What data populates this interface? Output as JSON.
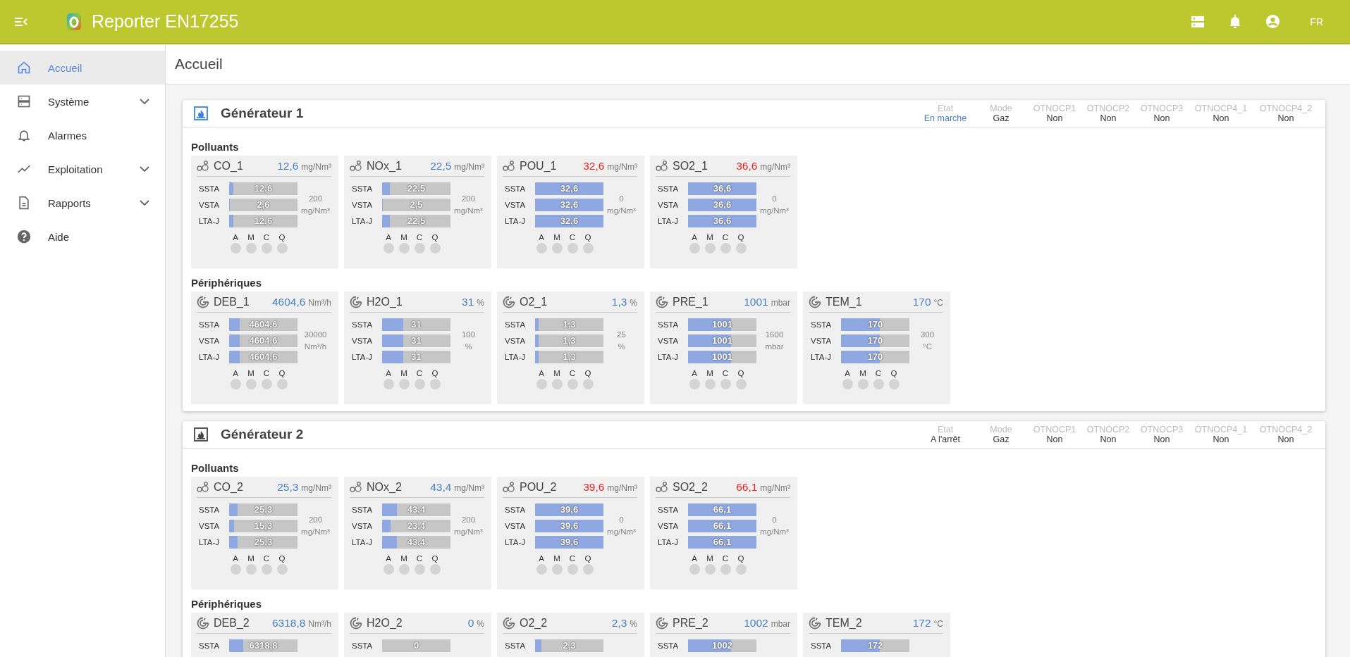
{
  "header": {
    "title": "Reporter EN17255",
    "language": "FR"
  },
  "sidebar": {
    "items": [
      {
        "label": "Accueil",
        "selected": true,
        "expandable": false
      },
      {
        "label": "Système",
        "selected": false,
        "expandable": true
      },
      {
        "label": "Alarmes",
        "selected": false,
        "expandable": false
      },
      {
        "label": "Exploitation",
        "selected": false,
        "expandable": true
      },
      {
        "label": "Rapports",
        "selected": false,
        "expandable": true
      },
      {
        "label": "Aide",
        "selected": false,
        "expandable": false
      }
    ]
  },
  "page_title": "Accueil",
  "generators": [
    {
      "name": "Générateur 1",
      "running": true,
      "status": [
        {
          "label": "Etat",
          "value": "En marche",
          "highlight": true
        },
        {
          "label": "Mode",
          "value": "Gaz",
          "highlight": false
        },
        {
          "label": "OTNOCP1",
          "value": "Non",
          "highlight": false
        },
        {
          "label": "OTNOCP2",
          "value": "Non",
          "highlight": false
        },
        {
          "label": "OTNOCP3",
          "value": "Non",
          "highlight": false
        },
        {
          "label": "OTNOCP4_1",
          "value": "Non",
          "highlight": false
        },
        {
          "label": "OTNOCP4_2",
          "value": "Non",
          "highlight": false
        }
      ],
      "sections": [
        {
          "title": "Polluants",
          "kind": "pollutant",
          "sensors": [
            {
              "name": "CO_1",
              "value": "12,6",
              "unit": "mg/Nm³",
              "alarm": false,
              "limit": "200",
              "limit_unit": "mg/Nm³",
              "rows": [
                {
                  "label": "SSTA",
                  "value": "12,6",
                  "level": 0.06
                },
                {
                  "label": "VSTA",
                  "value": "2,6",
                  "level": 0.013
                },
                {
                  "label": "LTA-J",
                  "value": "12,6",
                  "level": 0.06
                }
              ],
              "flags": [
                {
                  "label": "A",
                  "on": false
                },
                {
                  "label": "M",
                  "on": false
                },
                {
                  "label": "C",
                  "on": false
                },
                {
                  "label": "Q",
                  "on": false
                }
              ]
            },
            {
              "name": "NOx_1",
              "value": "22,5",
              "unit": "mg/Nm³",
              "alarm": false,
              "limit": "200",
              "limit_unit": "mg/Nm³",
              "rows": [
                {
                  "label": "SSTA",
                  "value": "22,5",
                  "level": 0.11
                },
                {
                  "label": "VSTA",
                  "value": "2,5",
                  "level": 0.013
                },
                {
                  "label": "LTA-J",
                  "value": "22,5",
                  "level": 0.11
                }
              ],
              "flags": [
                {
                  "label": "A",
                  "on": false
                },
                {
                  "label": "M",
                  "on": false
                },
                {
                  "label": "C",
                  "on": false
                },
                {
                  "label": "Q",
                  "on": false
                }
              ]
            },
            {
              "name": "POU_1",
              "value": "32,6",
              "unit": "mg/Nm³",
              "alarm": true,
              "limit": "0",
              "limit_unit": "mg/Nm³",
              "rows": [
                {
                  "label": "SSTA",
                  "value": "32,6",
                  "level": 1
                },
                {
                  "label": "VSTA",
                  "value": "32,6",
                  "level": 1
                },
                {
                  "label": "LTA-J",
                  "value": "32,6",
                  "level": 1
                }
              ],
              "flags": [
                {
                  "label": "A",
                  "on": false
                },
                {
                  "label": "M",
                  "on": false
                },
                {
                  "label": "C",
                  "on": false
                },
                {
                  "label": "Q",
                  "on": false
                }
              ]
            },
            {
              "name": "SO2_1",
              "value": "36,6",
              "unit": "mg/Nm³",
              "alarm": true,
              "limit": "0",
              "limit_unit": "mg/Nm³",
              "rows": [
                {
                  "label": "SSTA",
                  "value": "36,6",
                  "level": 1
                },
                {
                  "label": "VSTA",
                  "value": "36,6",
                  "level": 1
                },
                {
                  "label": "LTA-J",
                  "value": "36,6",
                  "level": 1
                }
              ],
              "flags": [
                {
                  "label": "A",
                  "on": false
                },
                {
                  "label": "M",
                  "on": false
                },
                {
                  "label": "C",
                  "on": false
                },
                {
                  "label": "Q",
                  "on": false
                }
              ]
            }
          ]
        },
        {
          "title": "Périphériques",
          "kind": "peripheral",
          "sensors": [
            {
              "name": "DEB_1",
              "value": "4604,6",
              "unit": "Nm³/h",
              "alarm": false,
              "limit": "30000",
              "limit_unit": "Nm³/h",
              "rows": [
                {
                  "label": "SSTA",
                  "value": "4604,6",
                  "level": 0.15
                },
                {
                  "label": "VSTA",
                  "value": "4604,6",
                  "level": 0.15
                },
                {
                  "label": "LTA-J",
                  "value": "4604,6",
                  "level": 0.15
                }
              ],
              "flags": [
                {
                  "label": "A",
                  "on": false
                },
                {
                  "label": "M",
                  "on": false
                },
                {
                  "label": "C",
                  "on": false
                },
                {
                  "label": "Q",
                  "on": false
                }
              ]
            },
            {
              "name": "H2O_1",
              "value": "31",
              "unit": "%",
              "alarm": false,
              "limit": "100",
              "limit_unit": "%",
              "rows": [
                {
                  "label": "SSTA",
                  "value": "31",
                  "level": 0.31
                },
                {
                  "label": "VSTA",
                  "value": "31",
                  "level": 0.31
                },
                {
                  "label": "LTA-J",
                  "value": "31",
                  "level": 0.31
                }
              ],
              "flags": [
                {
                  "label": "A",
                  "on": false
                },
                {
                  "label": "M",
                  "on": false
                },
                {
                  "label": "C",
                  "on": false
                },
                {
                  "label": "Q",
                  "on": false
                }
              ]
            },
            {
              "name": "O2_1",
              "value": "1,3",
              "unit": "%",
              "alarm": false,
              "limit": "25",
              "limit_unit": "%",
              "rows": [
                {
                  "label": "SSTA",
                  "value": "1,3",
                  "level": 0.05
                },
                {
                  "label": "VSTA",
                  "value": "1,3",
                  "level": 0.05
                },
                {
                  "label": "LTA-J",
                  "value": "1,3",
                  "level": 0.05
                }
              ],
              "flags": [
                {
                  "label": "A",
                  "on": false
                },
                {
                  "label": "M",
                  "on": false
                },
                {
                  "label": "C",
                  "on": false
                },
                {
                  "label": "Q",
                  "on": false
                }
              ]
            },
            {
              "name": "PRE_1",
              "value": "1001",
              "unit": "mbar",
              "alarm": false,
              "limit": "1600",
              "limit_unit": "mbar",
              "rows": [
                {
                  "label": "SSTA",
                  "value": "1001",
                  "level": 0.63
                },
                {
                  "label": "VSTA",
                  "value": "1001",
                  "level": 0.63
                },
                {
                  "label": "LTA-J",
                  "value": "1001",
                  "level": 0.63
                }
              ],
              "flags": [
                {
                  "label": "A",
                  "on": false
                },
                {
                  "label": "M",
                  "on": false
                },
                {
                  "label": "C",
                  "on": false
                },
                {
                  "label": "Q",
                  "on": false
                }
              ]
            },
            {
              "name": "TEM_1",
              "value": "170",
              "unit": "°C",
              "alarm": false,
              "limit": "300",
              "limit_unit": "°C",
              "rows": [
                {
                  "label": "SSTA",
                  "value": "170",
                  "level": 0.57
                },
                {
                  "label": "VSTA",
                  "value": "170",
                  "level": 0.57
                },
                {
                  "label": "LTA-J",
                  "value": "170",
                  "level": 0.57
                }
              ],
              "flags": [
                {
                  "label": "A",
                  "on": false
                },
                {
                  "label": "M",
                  "on": false
                },
                {
                  "label": "C",
                  "on": false
                },
                {
                  "label": "Q",
                  "on": false
                }
              ]
            }
          ]
        }
      ]
    },
    {
      "name": "Générateur 2",
      "running": false,
      "status": [
        {
          "label": "Etat",
          "value": "A l'arrêt",
          "highlight": false
        },
        {
          "label": "Mode",
          "value": "Gaz",
          "highlight": false
        },
        {
          "label": "OTNOCP1",
          "value": "Non",
          "highlight": false
        },
        {
          "label": "OTNOCP2",
          "value": "Non",
          "highlight": false
        },
        {
          "label": "OTNOCP3",
          "value": "Non",
          "highlight": false
        },
        {
          "label": "OTNOCP4_1",
          "value": "Non",
          "highlight": false
        },
        {
          "label": "OTNOCP4_2",
          "value": "Non",
          "highlight": false
        }
      ],
      "sections": [
        {
          "title": "Polluants",
          "kind": "pollutant",
          "sensors": [
            {
              "name": "CO_2",
              "value": "25,3",
              "unit": "mg/Nm³",
              "alarm": false,
              "limit": "200",
              "limit_unit": "mg/Nm³",
              "rows": [
                {
                  "label": "SSTA",
                  "value": "25,3",
                  "level": 0.127
                },
                {
                  "label": "VSTA",
                  "value": "15,3",
                  "level": 0.077
                },
                {
                  "label": "LTA-J",
                  "value": "25,3",
                  "level": 0.127
                }
              ],
              "flags": [
                {
                  "label": "A",
                  "on": false
                },
                {
                  "label": "M",
                  "on": false
                },
                {
                  "label": "C",
                  "on": false
                },
                {
                  "label": "Q",
                  "on": false
                }
              ]
            },
            {
              "name": "NOx_2",
              "value": "43,4",
              "unit": "mg/Nm³",
              "alarm": false,
              "limit": "200",
              "limit_unit": "mg/Nm³",
              "rows": [
                {
                  "label": "SSTA",
                  "value": "43,4",
                  "level": 0.22
                },
                {
                  "label": "VSTA",
                  "value": "23,4",
                  "level": 0.12
                },
                {
                  "label": "LTA-J",
                  "value": "43,4",
                  "level": 0.22
                }
              ],
              "flags": [
                {
                  "label": "A",
                  "on": false
                },
                {
                  "label": "M",
                  "on": false
                },
                {
                  "label": "C",
                  "on": false
                },
                {
                  "label": "Q",
                  "on": false
                }
              ]
            },
            {
              "name": "POU_2",
              "value": "39,6",
              "unit": "mg/Nm³",
              "alarm": true,
              "limit": "0",
              "limit_unit": "mg/Nm³",
              "rows": [
                {
                  "label": "SSTA",
                  "value": "39,6",
                  "level": 1
                },
                {
                  "label": "VSTA",
                  "value": "39,6",
                  "level": 1
                },
                {
                  "label": "LTA-J",
                  "value": "39,6",
                  "level": 1
                }
              ],
              "flags": [
                {
                  "label": "A",
                  "on": false
                },
                {
                  "label": "M",
                  "on": false
                },
                {
                  "label": "C",
                  "on": false
                },
                {
                  "label": "Q",
                  "on": false
                }
              ]
            },
            {
              "name": "SO2_2",
              "value": "66,1",
              "unit": "mg/Nm³",
              "alarm": true,
              "limit": "0",
              "limit_unit": "mg/Nm³",
              "rows": [
                {
                  "label": "SSTA",
                  "value": "66,1",
                  "level": 1
                },
                {
                  "label": "VSTA",
                  "value": "66,1",
                  "level": 1
                },
                {
                  "label": "LTA-J",
                  "value": "66,1",
                  "level": 1
                }
              ],
              "flags": [
                {
                  "label": "A",
                  "on": false
                },
                {
                  "label": "M",
                  "on": false
                },
                {
                  "label": "C",
                  "on": false
                },
                {
                  "label": "Q",
                  "on": false
                }
              ]
            }
          ]
        },
        {
          "title": "Périphériques",
          "kind": "peripheral",
          "sensors": [
            {
              "name": "DEB_2",
              "value": "6318,8",
              "unit": "Nm³/h",
              "alarm": false,
              "rows": [
                {
                  "label": "SSTA",
                  "value": "6318,8",
                  "level": 0.21
                }
              ]
            },
            {
              "name": "H2O_2",
              "value": "0",
              "unit": "%",
              "alarm": false,
              "rows": [
                {
                  "label": "SSTA",
                  "value": "0",
                  "level": 0
                }
              ]
            },
            {
              "name": "O2_2",
              "value": "2,3",
              "unit": "%",
              "alarm": false,
              "rows": [
                {
                  "label": "SSTA",
                  "value": "2,3",
                  "level": 0.09
                }
              ]
            },
            {
              "name": "PRE_2",
              "value": "1002",
              "unit": "mbar",
              "alarm": false,
              "rows": [
                {
                  "label": "SSTA",
                  "value": "1002",
                  "level": 0.63
                }
              ]
            },
            {
              "name": "TEM_2",
              "value": "172",
              "unit": "°C",
              "alarm": false,
              "rows": [
                {
                  "label": "SSTA",
                  "value": "172",
                  "level": 0.57
                }
              ]
            }
          ]
        }
      ]
    }
  ]
}
